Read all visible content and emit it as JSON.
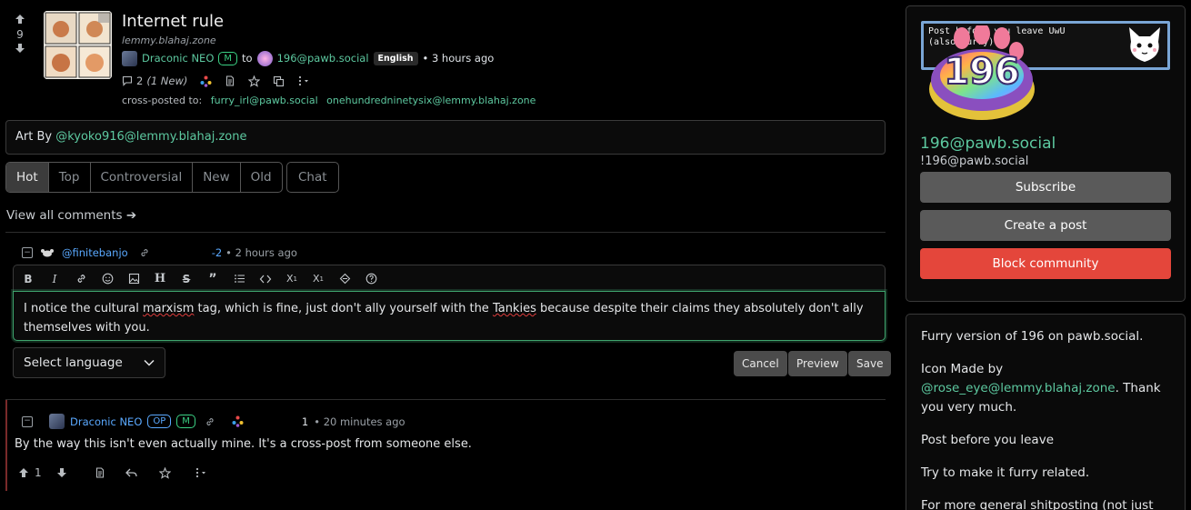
{
  "post": {
    "score": "9",
    "title": "Internet rule",
    "domain": "lemmy.blahaj.zone",
    "author": "Draconic NEO",
    "mod_badge": "M",
    "to_label": "to",
    "community": "196@pawb.social",
    "language": "English",
    "time": "• 3 hours ago",
    "comments_count": "2",
    "comments_new": "(1 New)",
    "crosspost_label": "cross-posted to:",
    "crosspost_targets": [
      "furry_irl@pawb.social",
      "onehundredninetysix@lemmy.blahaj.zone"
    ],
    "body_prefix": "Art By ",
    "body_link": "@kyoko916@lemmy.blahaj.zone"
  },
  "sort": {
    "tabs": [
      "Hot",
      "Top",
      "Controversial",
      "New",
      "Old"
    ],
    "active": "Hot",
    "chat": "Chat",
    "view_all": "View all comments ➔"
  },
  "comment1": {
    "author": "@finitebanjo",
    "score": "-2",
    "time": "• 2 hours ago"
  },
  "editor": {
    "text_parts": [
      "I notice the cultural ",
      "marxism",
      " tag, which is fine, just don't ally yourself with the ",
      "Tankies",
      " because despite their claims they absolutely don't ally themselves with you."
    ],
    "language_select": "Select language",
    "cancel": "Cancel",
    "preview": "Preview",
    "save": "Save"
  },
  "comment2": {
    "author": "Draconic NEO",
    "op_badge": "OP",
    "mod_badge": "M",
    "score": "1",
    "time": "• 20 minutes ago",
    "body": "By the way this isn't even actually mine. It's a cross-post from someone else.",
    "upvotes": "1"
  },
  "sidebar": {
    "banner_line1": "Post before you leave UwU",
    "banner_line2": "(also furry)",
    "logo_text": "196",
    "community_name": "196@pawb.social",
    "community_handle": "!196@pawb.social",
    "subscribe": "Subscribe",
    "create_post": "Create a post",
    "block": "Block community",
    "colors": {
      "block": "#e4463b",
      "gray": "#5a5a5a",
      "accent": "#5dc9a0"
    },
    "description": {
      "p1": "Furry version of 196 on pawb.social.",
      "p2_prefix": "Icon Made by ",
      "p2_link": "@rose_eye@lemmy.blahaj.zone",
      "p2_suffix": ". Thank you very much.",
      "p3": "Post before you leave",
      "p4": "Try to make it furry related.",
      "p5": "For more general shitposting (not just furry-"
    }
  }
}
